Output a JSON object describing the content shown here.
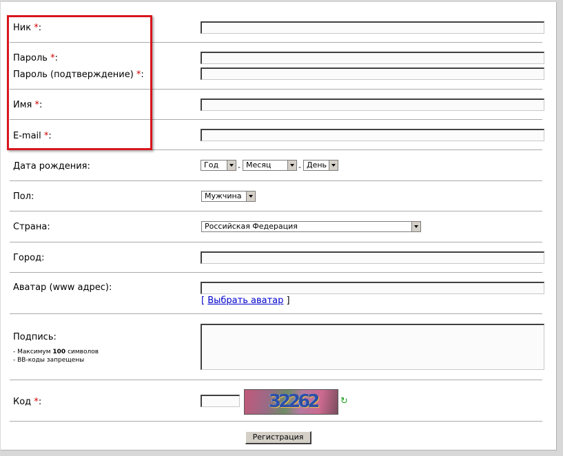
{
  "form": {
    "required_mark": "*",
    "nick": {
      "label": "Ник",
      "value": ""
    },
    "password": {
      "label": "Пароль",
      "value": ""
    },
    "password_confirm": {
      "label": "Пароль (подтверждение)",
      "value": ""
    },
    "name": {
      "label": "Имя",
      "value": ""
    },
    "email": {
      "label": "E-mail",
      "value": ""
    },
    "birthdate": {
      "label": "Дата рождения:",
      "year": "Год",
      "month": "Месяц",
      "day": "День",
      "separator": "-"
    },
    "gender": {
      "label": "Пол:",
      "selected": "Мужчина"
    },
    "country": {
      "label": "Страна:",
      "selected": "Российская Федерация"
    },
    "city": {
      "label": "Город:",
      "value": ""
    },
    "avatar": {
      "label": "Аватар (www адрес):",
      "value": "",
      "link_open": "[",
      "link_text": "Выбрать аватар",
      "link_close": "]"
    },
    "signature": {
      "label": "Подпись:",
      "hint1_prefix": "- Максимум",
      "hint1_bold": "100",
      "hint1_suffix": "символов",
      "hint2": "- BB-коды запрещены"
    },
    "code": {
      "label": "Код",
      "value": "",
      "captcha_text": "32262"
    },
    "submit_label": "Регистрация"
  },
  "colors": {
    "required": "#d00000",
    "highlight_box": "#d9151d",
    "link": "#0000cc"
  },
  "icons": {
    "refresh": "refresh-icon"
  }
}
